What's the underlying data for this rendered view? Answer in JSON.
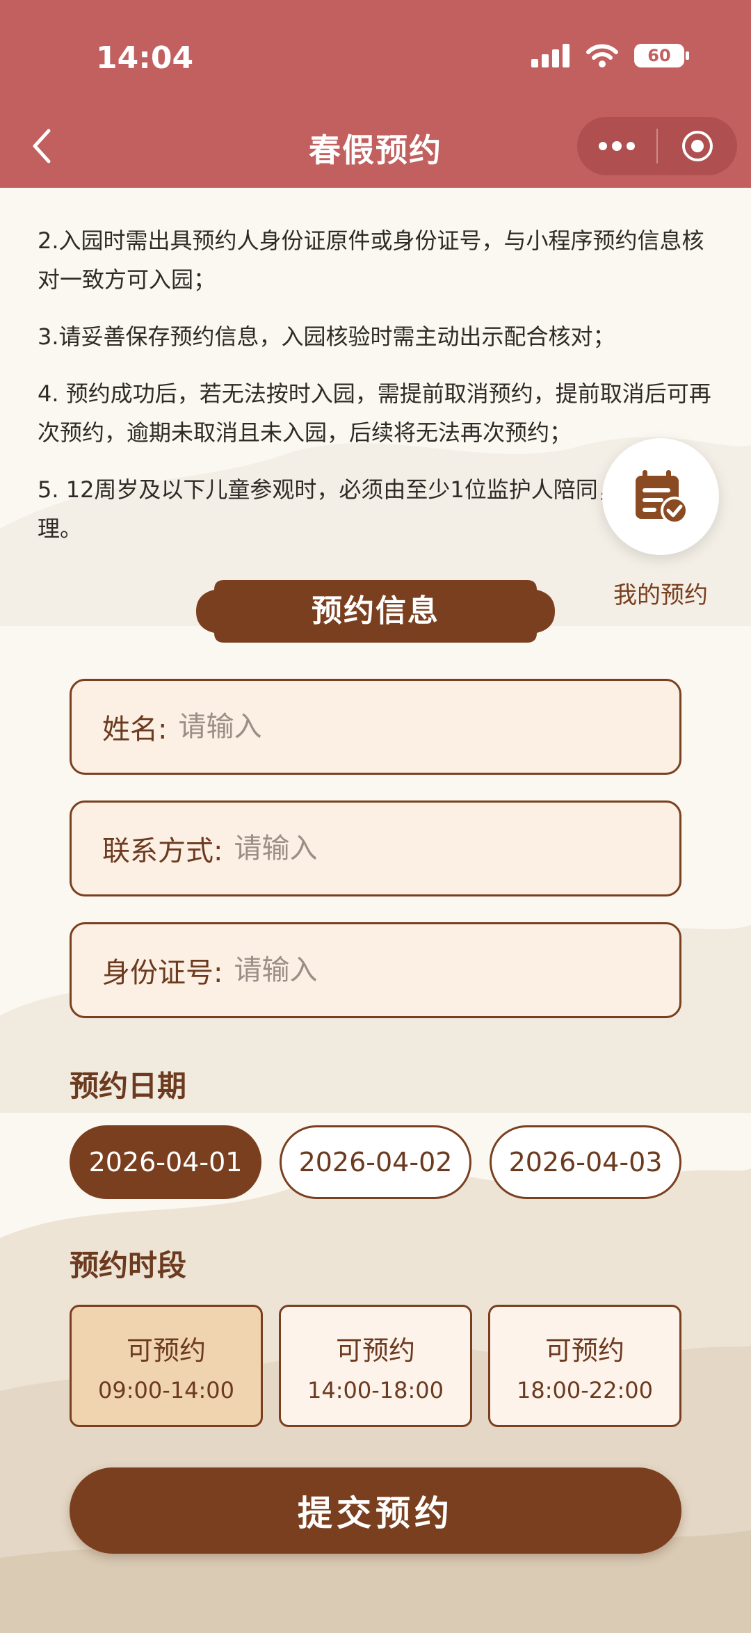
{
  "status_bar": {
    "time": "14:04",
    "battery": "60"
  },
  "nav": {
    "title": "春假预约",
    "back_icon": "chevron-left-icon",
    "more_icon": "more-dots-icon",
    "close_icon": "target-circle-icon"
  },
  "notes": [
    "2.入园时需出具预约人身份证原件或身份证号，与小程序预约信息核对一致方可入园；",
    "3.请妥善保存预约信息，入园核验时需主动出示配合核对；",
    "4. 预约成功后，若无法按时入园，需提前取消预约，提前取消后可再次预约，逾期未取消且未入园，后续将无法再次预约；",
    "5. 12周岁及以下儿童参观时，必须由至少1位监护人陪同，门票需自理。"
  ],
  "my_booking": {
    "label": "我的预约",
    "icon": "calendar-check-icon"
  },
  "section_title": "预约信息",
  "form": {
    "name": {
      "label": "姓名:",
      "placeholder": "请输入"
    },
    "phone": {
      "label": "联系方式:",
      "placeholder": "请输入"
    },
    "id_card": {
      "label": "身份证号:",
      "placeholder": "请输入"
    }
  },
  "date_section": {
    "title": "预约日期",
    "dates": [
      "2026-04-01",
      "2026-04-02",
      "2026-04-03"
    ],
    "selected_index": 0
  },
  "time_section": {
    "title": "预约时段",
    "slots": [
      {
        "status": "可预约",
        "time": "09:00-14:00"
      },
      {
        "status": "可预约",
        "time": "14:00-18:00"
      },
      {
        "status": "可预约",
        "time": "18:00-22:00"
      }
    ],
    "selected_index": 0
  },
  "submit_label": "提交预约",
  "colors": {
    "header": "#c25f5f",
    "brand_brown": "#7a3f1f",
    "slot_selected": "#f0d4b0",
    "field_bg": "#fcefe3"
  }
}
